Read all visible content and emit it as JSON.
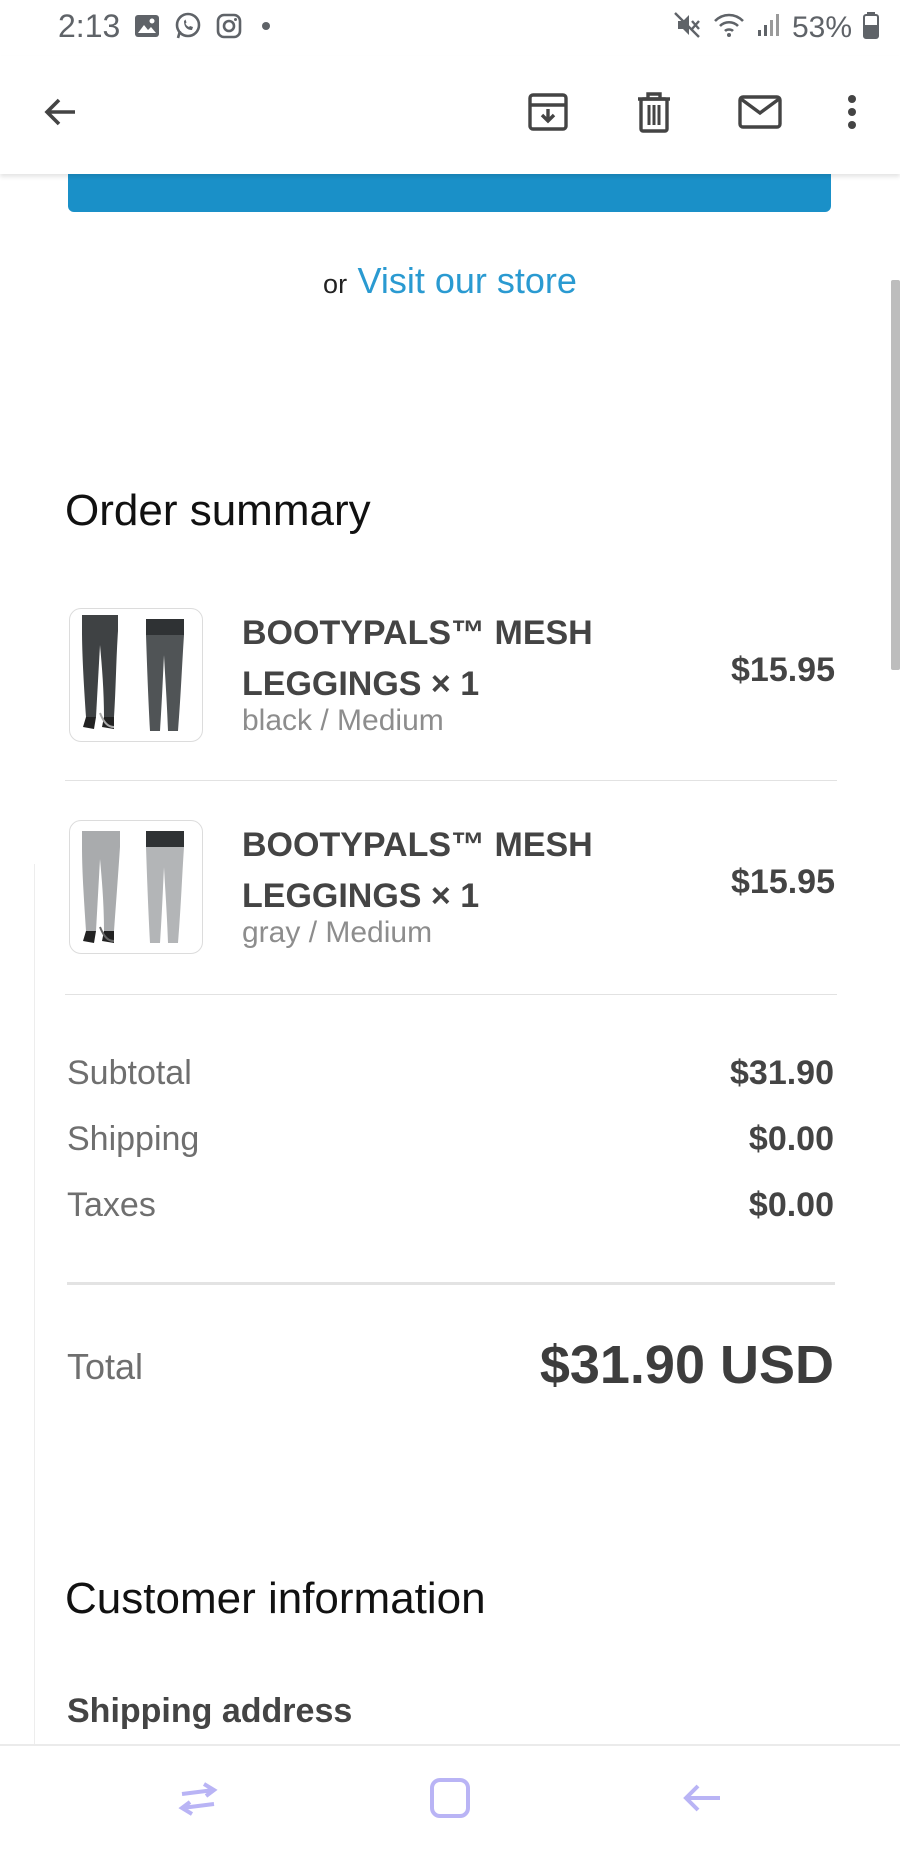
{
  "status_bar": {
    "time": "2:13",
    "battery": "53%",
    "left_icons": [
      "gallery-icon",
      "whatsapp-icon",
      "instagram-icon",
      "dot-icon"
    ],
    "right_icons": [
      "mute-icon",
      "wifi-icon",
      "signal-icon",
      "battery-icon"
    ]
  },
  "toolbar": {
    "icons": [
      "back-arrow-icon",
      "archive-icon",
      "delete-icon",
      "mail-icon",
      "more-vert-icon"
    ]
  },
  "cta": {
    "or_text": "or",
    "visit_link": "Visit our store",
    "color": "#1a90c8"
  },
  "order_summary": {
    "title": "Order summary",
    "items": [
      {
        "title_line1": "BOOTYPALS™ MESH",
        "title_line2": "LEGGINGS × 1",
        "variant": "black / Medium",
        "price": "$15.95"
      },
      {
        "title_line1": "BOOTYPALS™ MESH",
        "title_line2": "LEGGINGS × 1",
        "variant": "gray / Medium",
        "price": "$15.95"
      }
    ],
    "subtotal_label": "Subtotal",
    "subtotal_value": "$31.90",
    "shipping_label": "Shipping",
    "shipping_value": "$0.00",
    "taxes_label": "Taxes",
    "taxes_value": "$0.00",
    "total_label": "Total",
    "total_value": "$31.90 USD"
  },
  "customer_information": {
    "title": "Customer information",
    "shipping_address_label": "Shipping address"
  },
  "nav_bar": {
    "icons": [
      "recents-icon",
      "home-icon",
      "back-icon"
    ],
    "accent": "#b9b4f5"
  }
}
